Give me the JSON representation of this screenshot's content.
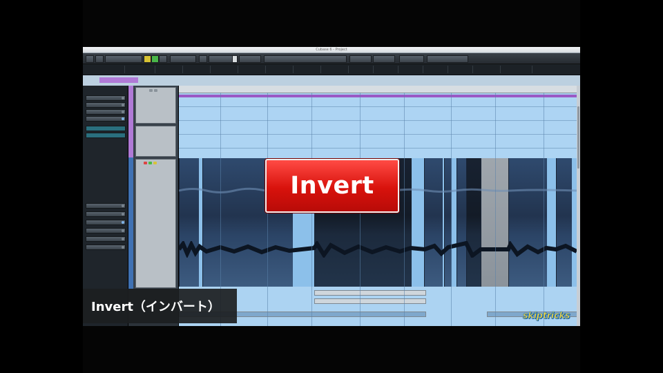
{
  "window": {
    "title": "Cubase 6 - Project"
  },
  "toolbar": {
    "buttons": [
      "",
      "",
      "",
      "",
      "",
      "",
      "",
      "",
      "",
      "",
      "",
      "",
      "",
      "",
      ""
    ]
  },
  "overlay": {
    "tool_name": "Invert",
    "caption": "Invert（インバート）",
    "logo": "skiptricks"
  },
  "colors": {
    "accent_red": "#e0201a",
    "event_blue": "#a8d0f0",
    "purple_track": "#9b59c4",
    "logo_yellow": "#f6d640"
  },
  "icons": [
    "close-icon",
    "gear-icon",
    "play-icon",
    "stop-icon",
    "record-icon",
    "mute-icon",
    "solo-icon"
  ]
}
